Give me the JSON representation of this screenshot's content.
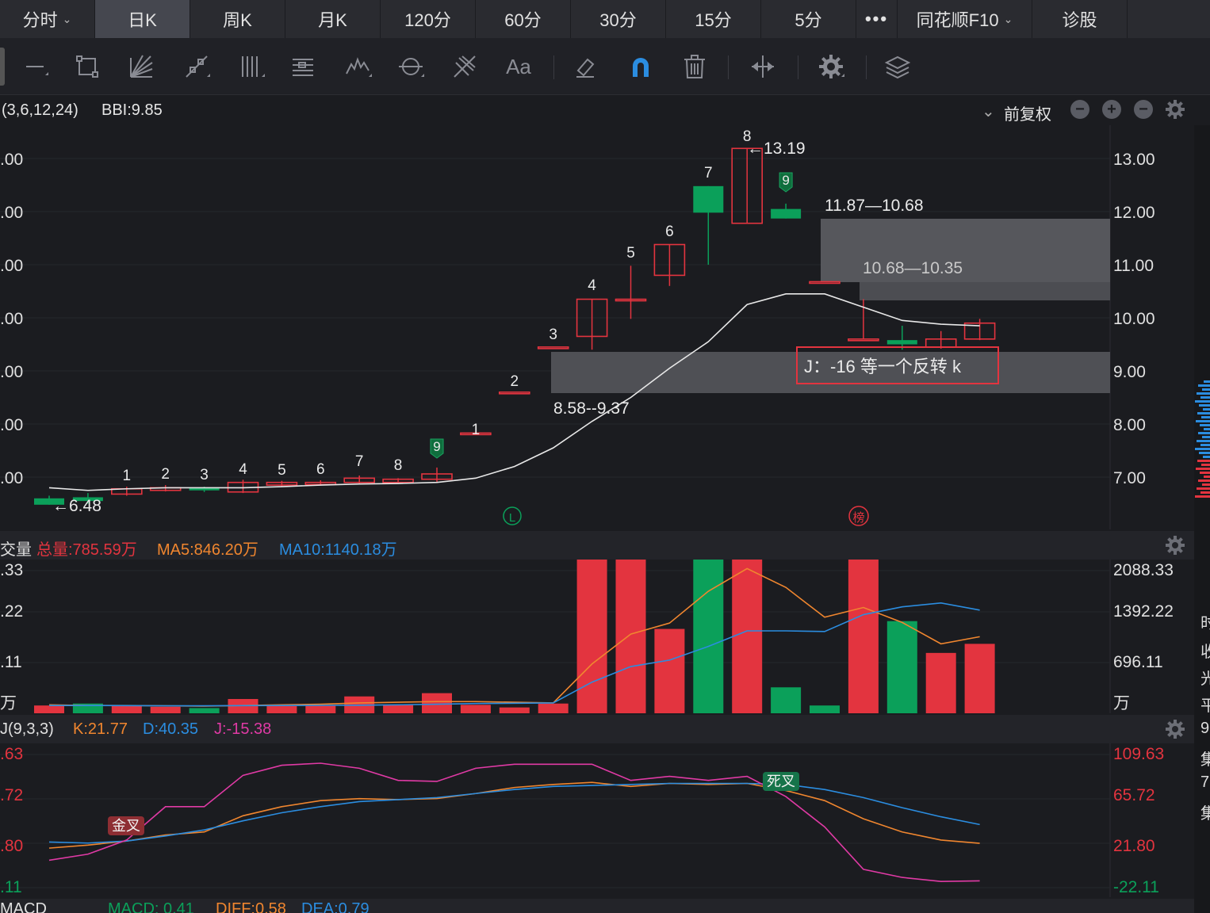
{
  "tabs": [
    {
      "label": "分时",
      "chevron": true
    },
    {
      "label": "日K",
      "active": true
    },
    {
      "label": "周K"
    },
    {
      "label": "月K"
    },
    {
      "label": "120分"
    },
    {
      "label": "60分"
    },
    {
      "label": "30分"
    },
    {
      "label": "15分"
    },
    {
      "label": "5分"
    },
    {
      "label": "•••"
    },
    {
      "label": "同花顺F10",
      "chevron": true
    },
    {
      "label": "诊股"
    }
  ],
  "toolbar": {
    "tools": [
      "line-tool-icon",
      "rectangle-tool-icon",
      "fan-tool-icon",
      "trend-tool-icon",
      "vertical-lines-tool-icon",
      "gann-tool-icon",
      "wave-tool-icon",
      "cycle-tool-icon",
      "fib-tool-icon",
      "text-tool-icon",
      "eraser-tool-icon",
      "magnet-tool-icon",
      "trash-icon",
      "measure-tool-icon",
      "settings-icon",
      "layers-icon"
    ],
    "text_tool_label": "Aa"
  },
  "kline_header": {
    "indicator": "(3,6,12,24)",
    "bbi": "BBI:9.85",
    "adjust": "前复权",
    "adjust_chevron": "⌄"
  },
  "kline": {
    "y_ticks_left": [
      "13.00",
      "12.00",
      "11.00",
      "10.00",
      "9.00",
      "8.00",
      "7.00"
    ],
    "y_ticks_left_display": [
      ".00",
      ".00",
      ".00",
      ".00",
      ".00",
      ".00",
      ".00"
    ],
    "y_ticks_right": [
      "13.00",
      "12.00",
      "11.00",
      "10.00",
      "9.00",
      "8.00",
      "7.00"
    ],
    "low_label": "6.48",
    "high_label": "13.19",
    "zone_top_label": "11.87—10.68",
    "zone_mid_label": "10.68—10.35",
    "zone_low_label": "8.58--9.37",
    "note": "J：-16 等一个反转 k",
    "l_marker": "L",
    "bang_marker": "榜",
    "seq_counts": [
      "1",
      "2",
      "3",
      "4",
      "5",
      "6",
      "7",
      "8",
      "9",
      "1",
      "2",
      "3",
      "4",
      "5",
      "6",
      "7",
      "8",
      "9"
    ],
    "colors": {
      "up": "#e3343f",
      "down": "#0ba05a",
      "bbi": "#e8e8e8"
    }
  },
  "chart_data": [
    {
      "type": "candlestick",
      "title": "日K",
      "ylim": [
        6.3,
        13.4
      ],
      "series": [
        {
          "name": "BBI",
          "values": [
            6.8,
            6.75,
            6.78,
            6.8,
            6.8,
            6.8,
            6.82,
            6.85,
            6.87,
            6.88,
            6.9,
            6.98,
            7.2,
            7.55,
            8.05,
            8.5,
            9.05,
            9.55,
            10.25,
            10.45,
            10.45,
            10.2,
            9.95,
            9.88,
            9.85
          ],
          "x_start": 0
        }
      ],
      "candles": [
        {
          "o": 6.6,
          "c": 6.48,
          "h": 6.65,
          "l": 6.48
        },
        {
          "o": 6.62,
          "c": 6.55,
          "h": 6.7,
          "l": 6.5
        },
        {
          "o": 6.68,
          "c": 6.78,
          "h": 6.82,
          "l": 6.65
        },
        {
          "o": 6.75,
          "c": 6.8,
          "h": 6.85,
          "l": 6.73
        },
        {
          "o": 6.8,
          "c": 6.75,
          "h": 6.82,
          "l": 6.72
        },
        {
          "o": 6.72,
          "c": 6.9,
          "h": 6.95,
          "l": 6.7
        },
        {
          "o": 6.85,
          "c": 6.9,
          "h": 6.93,
          "l": 6.82
        },
        {
          "o": 6.86,
          "c": 6.9,
          "h": 6.94,
          "l": 6.84
        },
        {
          "o": 6.9,
          "c": 6.98,
          "h": 7.03,
          "l": 6.88
        },
        {
          "o": 6.9,
          "c": 6.96,
          "h": 6.98,
          "l": 6.88
        },
        {
          "o": 6.96,
          "c": 7.06,
          "h": 7.18,
          "l": 6.9
        },
        {
          "o": 7.83,
          "c": 7.83,
          "h": 7.83,
          "l": 7.83
        },
        {
          "o": 8.6,
          "c": 8.6,
          "h": 8.6,
          "l": 8.6
        },
        {
          "o": 9.45,
          "c": 9.45,
          "h": 9.45,
          "l": 9.45
        },
        {
          "o": 9.65,
          "c": 10.35,
          "h": 10.35,
          "l": 9.4
        },
        {
          "o": 10.35,
          "c": 10.35,
          "h": 10.98,
          "l": 9.98
        },
        {
          "o": 10.8,
          "c": 11.38,
          "h": 11.38,
          "l": 10.6
        },
        {
          "o": 12.48,
          "c": 11.98,
          "h": 12.48,
          "l": 11.0
        },
        {
          "o": 11.78,
          "c": 13.19,
          "h": 13.19,
          "l": 11.78
        },
        {
          "o": 12.05,
          "c": 11.87,
          "h": 12.15,
          "l": 11.87
        },
        {
          "o": 10.68,
          "c": 10.68,
          "h": 10.68,
          "l": 10.68
        },
        {
          "o": 9.6,
          "c": 9.6,
          "h": 10.35,
          "l": 9.6
        },
        {
          "o": 9.58,
          "c": 9.5,
          "h": 9.85,
          "l": 9.4
        },
        {
          "o": 9.45,
          "c": 9.6,
          "h": 9.75,
          "l": 9.42
        },
        {
          "o": 9.6,
          "c": 9.9,
          "h": 9.98,
          "l": 9.58
        }
      ]
    },
    {
      "type": "bar",
      "title": "成交量",
      "ylim": [
        0,
        2088.33
      ],
      "values": [
        120,
        150,
        110,
        100,
        80,
        220,
        110,
        120,
        260,
        130,
        310,
        130,
        90,
        150,
        2600,
        2750,
        1300,
        2760,
        2760,
        400,
        120,
        2380,
        1420,
        930,
        1070
      ],
      "colors": [
        "up",
        "down",
        "up",
        "up",
        "down",
        "up",
        "up",
        "up",
        "up",
        "up",
        "up",
        "up",
        "up",
        "up",
        "up",
        "up",
        "up",
        "down",
        "up",
        "down",
        "down",
        "up",
        "down",
        "up",
        "up"
      ],
      "series": [
        {
          "name": "MA5",
          "values": [
            130,
            120,
            120,
            115,
            110,
            120,
            130,
            140,
            160,
            170,
            180,
            180,
            170,
            160,
            760,
            1220,
            1390,
            1880,
            2230,
            1940,
            1480,
            1630,
            1400,
            1070,
            1180
          ]
        },
        {
          "name": "MA10",
          "values": [
            120,
            120,
            118,
            115,
            115,
            118,
            120,
            122,
            125,
            130,
            140,
            150,
            155,
            160,
            480,
            720,
            820,
            1030,
            1270,
            1270,
            1260,
            1520,
            1640,
            1700,
            1590
          ]
        }
      ]
    },
    {
      "type": "line",
      "title": "KDJ(9,3,3)",
      "ylim": [
        -22.11,
        109.63
      ],
      "series": [
        {
          "name": "K",
          "values": [
            17,
            20,
            24,
            30,
            33,
            49,
            58,
            64,
            66,
            65,
            66,
            71,
            77,
            80,
            82,
            78,
            81,
            80,
            81,
            74,
            64,
            46,
            33,
            25,
            21.77
          ]
        },
        {
          "name": "D",
          "values": [
            23,
            22,
            24,
            29,
            35,
            44,
            52,
            58,
            63,
            65,
            67,
            71,
            75,
            78,
            79,
            80,
            81,
            81,
            81,
            80,
            75,
            67,
            57,
            48,
            40.35
          ]
        },
        {
          "name": "J",
          "values": [
            5,
            11,
            25,
            58,
            58,
            89,
            99,
            101,
            96,
            84,
            83,
            96,
            100,
            100,
            100,
            84,
            88,
            84,
            88,
            68,
            38,
            -4,
            -12,
            -16,
            -15.38
          ]
        }
      ]
    }
  ],
  "volume_header": {
    "label": "交量",
    "total": "总量:785.59万",
    "ma5": "MA5:846.20万",
    "ma10": "MA10:1140.18万"
  },
  "volume": {
    "y_left": [
      ".33",
      ".22",
      ".11",
      "万"
    ],
    "y_right": [
      "2088.33",
      "1392.22",
      "696.11",
      "万"
    ]
  },
  "kdj_header": {
    "label": "J(9,3,3)",
    "k": "K:21.77",
    "d": "D:40.35",
    "j": "J:-15.38"
  },
  "kdj": {
    "y_left": [
      ".63",
      ".72",
      ".80",
      ".11"
    ],
    "y_right": [
      "109.63",
      "65.72",
      "21.80",
      "-22.11"
    ],
    "golden_cross": "金叉",
    "death_cross": "死叉"
  },
  "macd_header": {
    "label": "MACD",
    "macd": "MACD: 0.41",
    "diff": "DIFF:0.58",
    "dea": "DEA:0.79"
  },
  "right_strip": [
    "时",
    "收",
    "光",
    "平",
    "9",
    "集",
    "7",
    "集"
  ],
  "colors": {
    "up": "#e3343f",
    "down": "#0ba05a",
    "k": "#f0862f",
    "d": "#2b8de0",
    "j": "#e03aa5",
    "ma5": "#f0862f",
    "ma10": "#2b8de0",
    "zone": "#5a5b60"
  }
}
